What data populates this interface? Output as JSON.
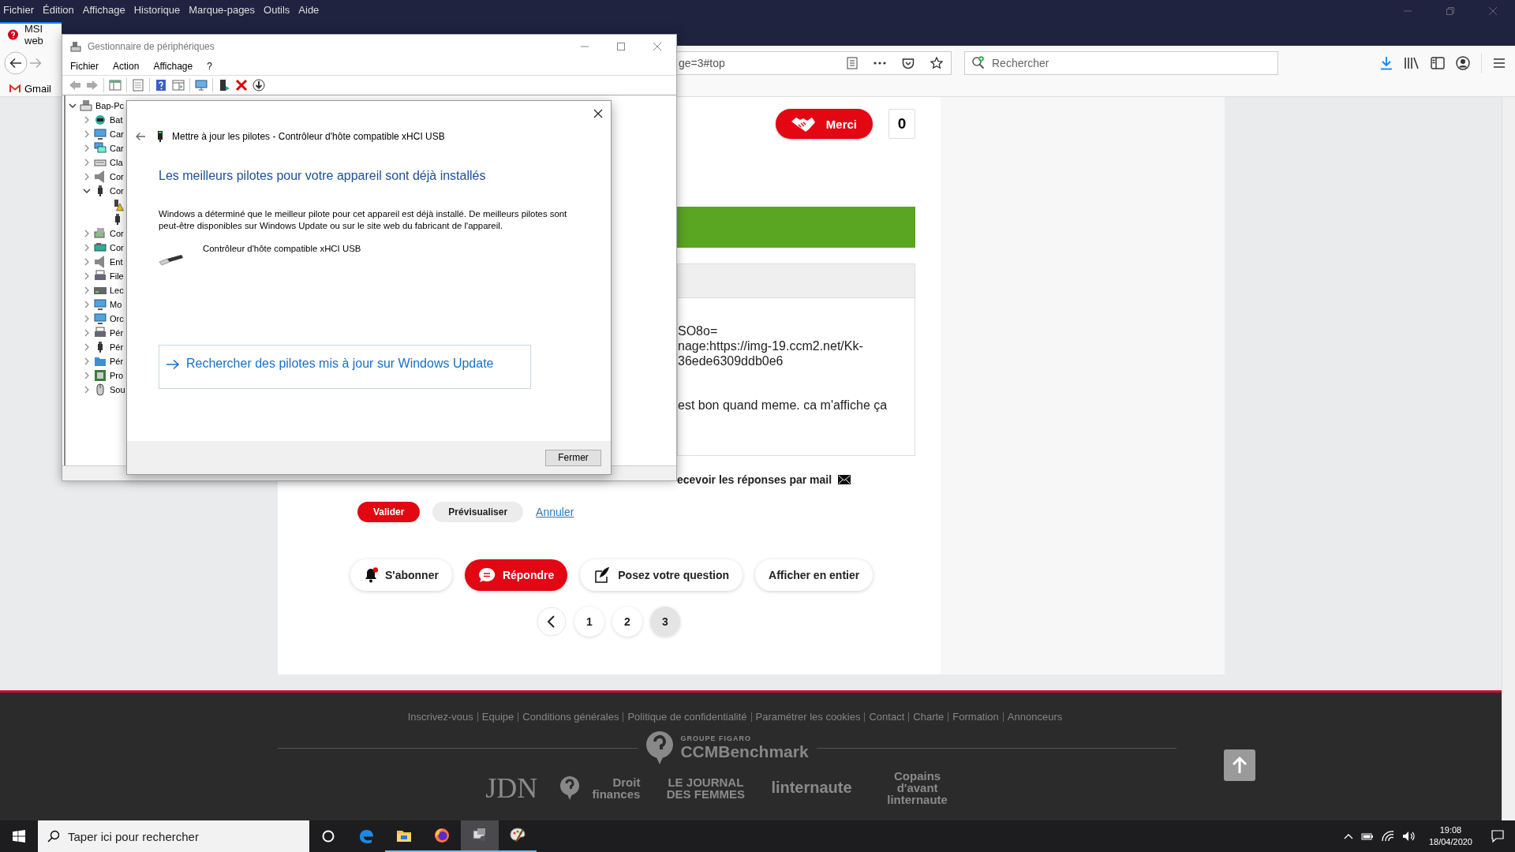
{
  "browser": {
    "menu": [
      "Fichier",
      "Édition",
      "Affichage",
      "Historique",
      "Marque-pages",
      "Outils",
      "Aide"
    ],
    "tab": {
      "title": "MSI web",
      "selected": true
    },
    "url": "ge=3#top",
    "search": {
      "placeholder": "Rechercher"
    },
    "bookmarks": [
      "Gmail"
    ]
  },
  "page": {
    "thanks": {
      "label": "Merci",
      "count": "0"
    },
    "message_lines": [
      "SO8o=",
      "nage:https://img-19.ccm2.net/Kk-",
      "36ede6309ddb0e6"
    ],
    "message_tail": "est bon quand meme. ca m'affiche ça",
    "notify_label": "ecevoir les réponses par mail",
    "form_buttons": [
      {
        "label": "Valider",
        "kind": "primary"
      },
      {
        "label": "Prévisualiser",
        "kind": "secondary"
      },
      {
        "label": "Annuler",
        "kind": "link"
      }
    ],
    "actions": [
      {
        "label": "S'abonner",
        "kind": "bell"
      },
      {
        "label": "Répondre",
        "kind": "reply"
      },
      {
        "label": "Posez votre question",
        "kind": "quill"
      },
      {
        "label": "Afficher en entier",
        "kind": "plain"
      }
    ],
    "pagination": [
      {
        "label": "1",
        "selected": false
      },
      {
        "label": "2",
        "selected": false
      },
      {
        "label": "3",
        "selected": true
      }
    ]
  },
  "footer": {
    "links": [
      "Inscrivez-vous",
      "Equipe",
      "Conditions générales",
      "Politique de confidentialité",
      "Paramétrer les cookies",
      "Contact",
      "Charte",
      "Formation",
      "Annonceurs"
    ],
    "group_logo": {
      "line1": "GROUPE FIGARO",
      "line2": "CCMBenchmark"
    },
    "brands": [
      {
        "label": "JDN",
        "kind": "serif"
      },
      {
        "label": "Droit finances",
        "kind": "badge"
      },
      {
        "label": "LE JOURNAL DES FEMMES",
        "kind": "stacked"
      },
      {
        "label": "linternaute",
        "kind": "sans"
      },
      {
        "label": "Copains d'avant linternaute",
        "kind": "stacked"
      }
    ]
  },
  "device_manager": {
    "title": "Gestionnaire de périphériques",
    "menu": [
      "Fichier",
      "Action",
      "Affichage",
      "?"
    ],
    "tree": {
      "label": "Bap-Pc",
      "kind": "computer",
      "expanded": true,
      "children": [
        {
          "label": "Bat",
          "kind": "battery",
          "expanded": false
        },
        {
          "label": "Car",
          "kind": "monitor",
          "expanded": false
        },
        {
          "label": "Car",
          "kind": "network",
          "expanded": false
        },
        {
          "label": "Cla",
          "kind": "keyboard",
          "expanded": false
        },
        {
          "label": "Cor",
          "kind": "audio",
          "expanded": false
        },
        {
          "label": "Cor",
          "kind": "usb",
          "expanded": true,
          "children": [
            {
              "kind": "usb-warning"
            },
            {
              "kind": "usb"
            }
          ]
        },
        {
          "label": "Cor",
          "kind": "storage",
          "expanded": false
        },
        {
          "label": "Cor",
          "kind": "card",
          "expanded": false
        },
        {
          "label": "Ent",
          "kind": "audio",
          "expanded": false
        },
        {
          "label": "File",
          "kind": "printer",
          "expanded": false
        },
        {
          "label": "Lec",
          "kind": "drive",
          "expanded": false
        },
        {
          "label": "Mo",
          "kind": "monitor",
          "expanded": false
        },
        {
          "label": "Orc",
          "kind": "monitor",
          "expanded": false
        },
        {
          "label": "Pér",
          "kind": "printer",
          "expanded": false
        },
        {
          "label": "Pér",
          "kind": "usb",
          "expanded": false
        },
        {
          "label": "Pér",
          "kind": "folder",
          "expanded": false
        },
        {
          "label": "Pro",
          "kind": "cpu",
          "expanded": false
        },
        {
          "label": "Sou",
          "kind": "mouse",
          "expanded": false
        }
      ]
    }
  },
  "dialog": {
    "title": "Mettre à jour les pilotes - Contrôleur d'hôte compatible xHCI USB",
    "heading": "Les meilleurs pilotes pour votre appareil sont déjà installés",
    "message": "Windows a déterminé que le meilleur pilote pour cet appareil est déjà installé. De meilleurs pilotes sont peut-être disponibles sur Windows Update ou sur le site web du fabricant de l'appareil.",
    "device": "Contrôleur d'hôte compatible xHCI USB",
    "link": "Rechercher des pilotes mis à jour sur Windows Update",
    "button": "Fermer"
  },
  "taskbar": {
    "search": {
      "placeholder": "Taper ici pour rechercher"
    },
    "apps": [
      {
        "kind": "cortana",
        "running": false,
        "selected": false
      },
      {
        "kind": "edge",
        "running": false,
        "selected": false
      },
      {
        "kind": "explorer",
        "running": true,
        "selected": false
      },
      {
        "kind": "firefox",
        "running": true,
        "selected": false
      },
      {
        "kind": "devmgr",
        "running": true,
        "selected": true
      },
      {
        "kind": "paint",
        "running": true,
        "selected": false
      }
    ],
    "time": "19:08",
    "date": "18/04/2020"
  }
}
